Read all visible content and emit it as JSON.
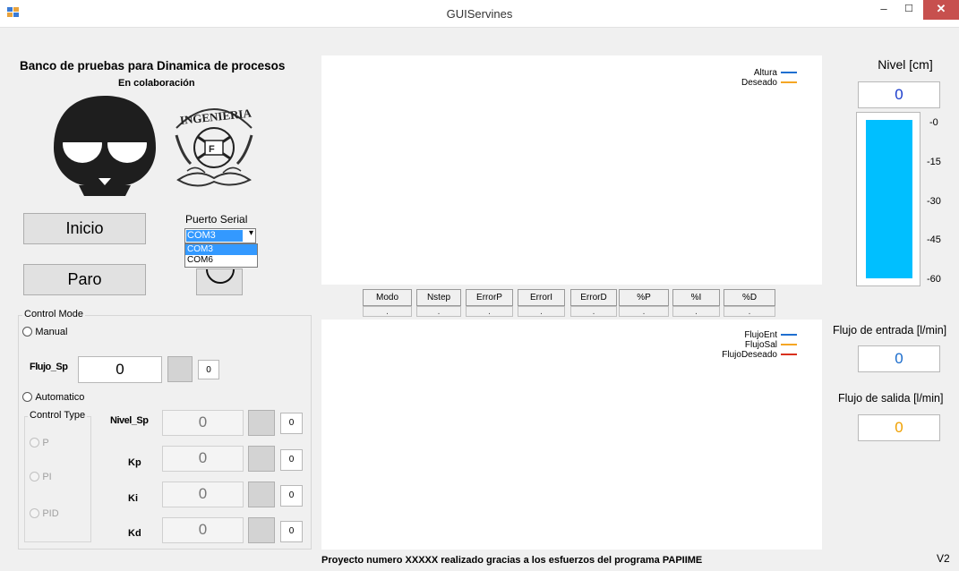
{
  "window": {
    "title": "GUIServines",
    "min": "‒",
    "max": "☐",
    "close": "✕"
  },
  "header": {
    "title": "Banco de pruebas para Dinamica de procesos",
    "subtitle": "En colaboración",
    "seal_text": "INGENIERIA"
  },
  "buttons": {
    "inicio": "Inicio",
    "paro": "Paro"
  },
  "serial": {
    "label": "Puerto Serial",
    "selected": "COM3",
    "options": [
      "COM3",
      "COM6"
    ]
  },
  "control_mode": {
    "title": "Control Mode",
    "manual": "Manual",
    "automatico": "Automatico",
    "flujo_sp_label": "Flujo_Sp",
    "flujo_sp_value": "0",
    "flujo_sp_small": "0"
  },
  "control_type": {
    "title": "Control Type",
    "p": "P",
    "pi": "PI",
    "pid": "PID"
  },
  "params": [
    {
      "label": "Nivel_Sp",
      "value": "0",
      "small": "0"
    },
    {
      "label": "Kp",
      "value": "0",
      "small": "0"
    },
    {
      "label": "Ki",
      "value": "0",
      "small": "0"
    },
    {
      "label": "Kd",
      "value": "0",
      "small": "0"
    }
  ],
  "chart_top": {
    "legend": [
      "Altura",
      "Deseado"
    ],
    "colors": [
      "#1f6fd0",
      "#f5a623"
    ]
  },
  "chart_bottom": {
    "legend": [
      "FlujoEnt",
      "FlujoSal",
      "FlujoDeseado"
    ],
    "colors": [
      "#1f6fd0",
      "#f5a623",
      "#d9301c"
    ]
  },
  "metrics": {
    "headers": [
      "Modo",
      "Nstep",
      "ErrorP",
      "ErrorI",
      "ErrorD",
      "%P",
      "%I",
      "%D"
    ],
    "values": [
      ".",
      ".",
      ".",
      ".",
      ".",
      ".",
      ".",
      "."
    ]
  },
  "nivel": {
    "title": "Nivel [cm]",
    "value": "0",
    "value_color": "#1a3ccc",
    "ticks": [
      "-0",
      "-15",
      "-30",
      "-45",
      "-60"
    ],
    "bar_color": "#00bfff",
    "fill_fraction": 1.0
  },
  "flujo_entrada": {
    "label": "Flujo de entrada [l/min]",
    "value": "0",
    "value_color": "#1a6ccc"
  },
  "flujo_salida": {
    "label": "Flujo de salida [l/min]",
    "value": "0",
    "value_color": "#f0a000"
  },
  "footer": {
    "text": "Proyecto numero XXXXX realizado gracias a los esfuerzos del programa PAPIIME",
    "version": "V2"
  }
}
